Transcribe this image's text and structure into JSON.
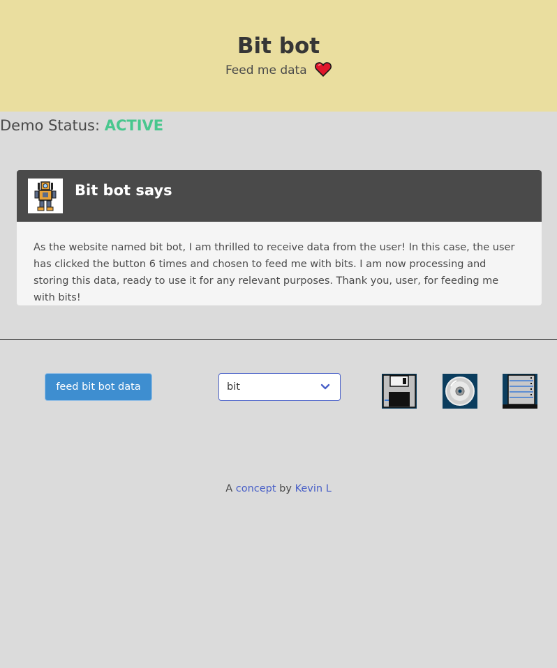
{
  "hero": {
    "title": "Bit bot",
    "subtitle": "Feed me data",
    "heart_icon": "heart-icon",
    "background": "#eade9f"
  },
  "status": {
    "label": "Demo Status:",
    "value": "ACTIVE",
    "value_color": "#48c78e"
  },
  "message": {
    "avatar_icon": "robot-avatar-icon",
    "title": "Bit bot says",
    "body": "As the website named bit bot, I am thrilled to receive data from the user! In this case, the user has clicked the button 6 times and chosen to feed me with bits. I am now processing and storing this data, ready to use it for any relevant purposes. Thank you, user, for feeding me with bits!"
  },
  "controls": {
    "feed_button_label": "feed bit bot data",
    "data_type_select": {
      "selected": "bit",
      "icon": "chevron-down-icon"
    },
    "storage_icons": [
      "floppy-disk-icon",
      "cd-disc-icon",
      "server-rack-icon"
    ],
    "accent_color": "#3e8ed0"
  },
  "footer": {
    "prefix": "A",
    "concept_link": "concept",
    "middle": "by",
    "author_link": "Kevin L"
  }
}
